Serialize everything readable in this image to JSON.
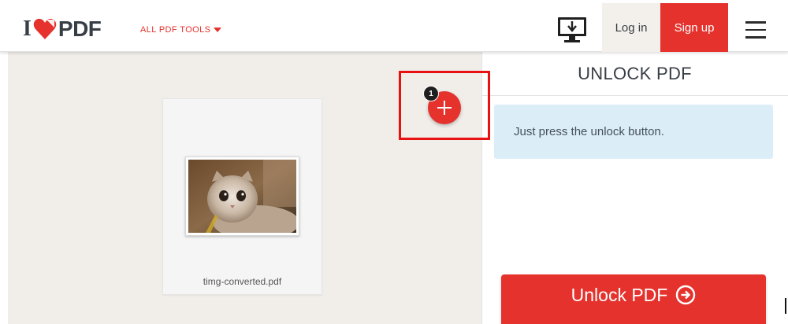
{
  "header": {
    "logo_i": "I",
    "logo_pdf": "PDF",
    "tools_menu_label": "ALL PDF TOOLS",
    "login_label": "Log in",
    "signup_label": "Sign up"
  },
  "workspace": {
    "file_name": "timg-converted.pdf",
    "file_count_badge": "1"
  },
  "sidebar": {
    "title": "UNLOCK PDF",
    "info_text": "Just press the unlock button.",
    "unlock_button_label": "Unlock PDF"
  },
  "colors": {
    "brand_red": "#e5322d",
    "info_bg": "#dbeef8",
    "workspace_bg": "#f1eeea",
    "highlight_red": "#e81212"
  },
  "icons": [
    "heart-logo-icon",
    "caret-down-icon",
    "desktop-download-icon",
    "hamburger-menu-icon",
    "plus-icon",
    "arrow-right-circle-icon"
  ]
}
